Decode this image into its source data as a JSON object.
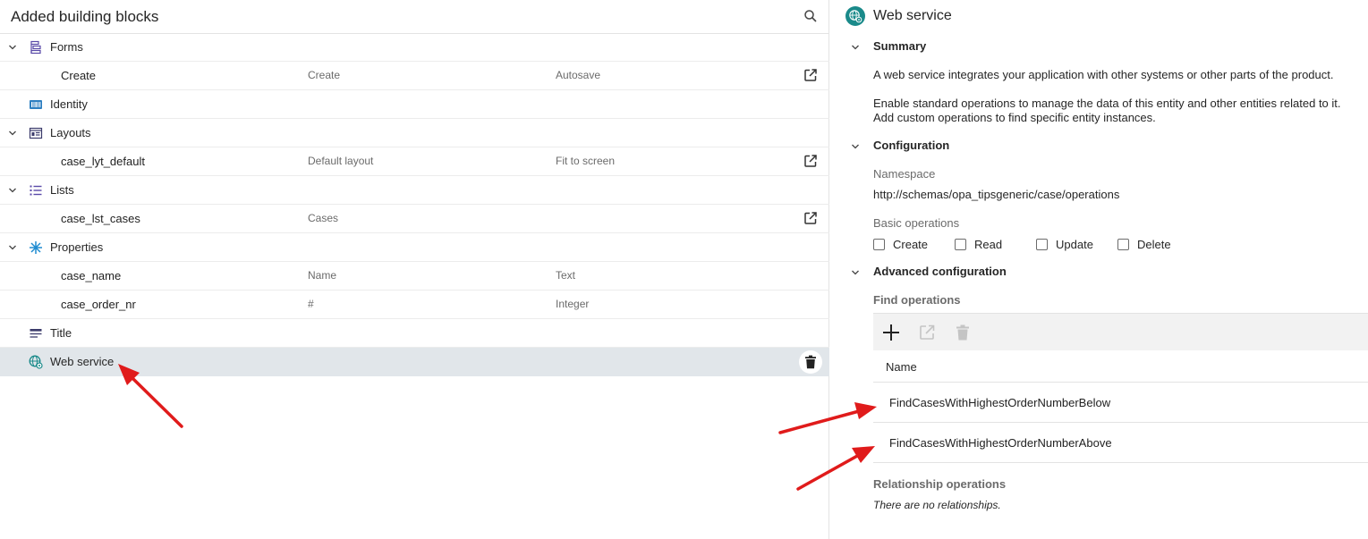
{
  "left": {
    "title": "Added building blocks",
    "categories": [
      {
        "label": "Forms",
        "icon": "form-icon"
      },
      {
        "label": "Identity",
        "icon": "identity-icon"
      },
      {
        "label": "Layouts",
        "icon": "layout-icon"
      },
      {
        "label": "Lists",
        "icon": "list-icon"
      },
      {
        "label": "Properties",
        "icon": "properties-icon"
      },
      {
        "label": "Title",
        "icon": "title-icon"
      },
      {
        "label": "Web service",
        "icon": "web-service-icon"
      }
    ],
    "items": [
      {
        "name": "Create",
        "col2": "Create",
        "col3": "Autosave"
      },
      {
        "name": "case_lyt_default",
        "col2": "Default layout",
        "col3": "Fit to screen"
      },
      {
        "name": "case_lst_cases",
        "col2": "Cases",
        "col3": ""
      },
      {
        "name": "case_name",
        "col2": "Name",
        "col3": "Text"
      },
      {
        "name": "case_order_nr",
        "col2": "#",
        "col3": "Integer"
      }
    ]
  },
  "right": {
    "title": "Web service",
    "summary": {
      "heading": "Summary",
      "line1": "A web service integrates your application with other systems or other parts of the product.",
      "line2": "Enable standard operations to manage the data of this entity and other entities related to it.",
      "line3": "Add custom operations to find specific entity instances."
    },
    "configuration": {
      "heading": "Configuration",
      "namespace_label": "Namespace",
      "namespace_value": "http://schemas/opa_tipsgeneric/case/operations",
      "basic_label": "Basic operations",
      "operations": [
        "Create",
        "Read",
        "Update",
        "Delete"
      ]
    },
    "advanced": {
      "heading": "Advanced configuration",
      "find_label": "Find operations",
      "column_name": "Name",
      "find_rows": [
        "FindCasesWithHighestOrderNumberBelow",
        "FindCasesWithHighestOrderNumberAbove"
      ],
      "relationship_label": "Relationship operations",
      "relationship_empty": "There are no relationships."
    }
  },
  "colors": {
    "accent_teal": "#1a8a8a",
    "category_icon": "#5a4aa8",
    "selected_row": "#e1e6ea",
    "arrow": "#e01b1b"
  }
}
